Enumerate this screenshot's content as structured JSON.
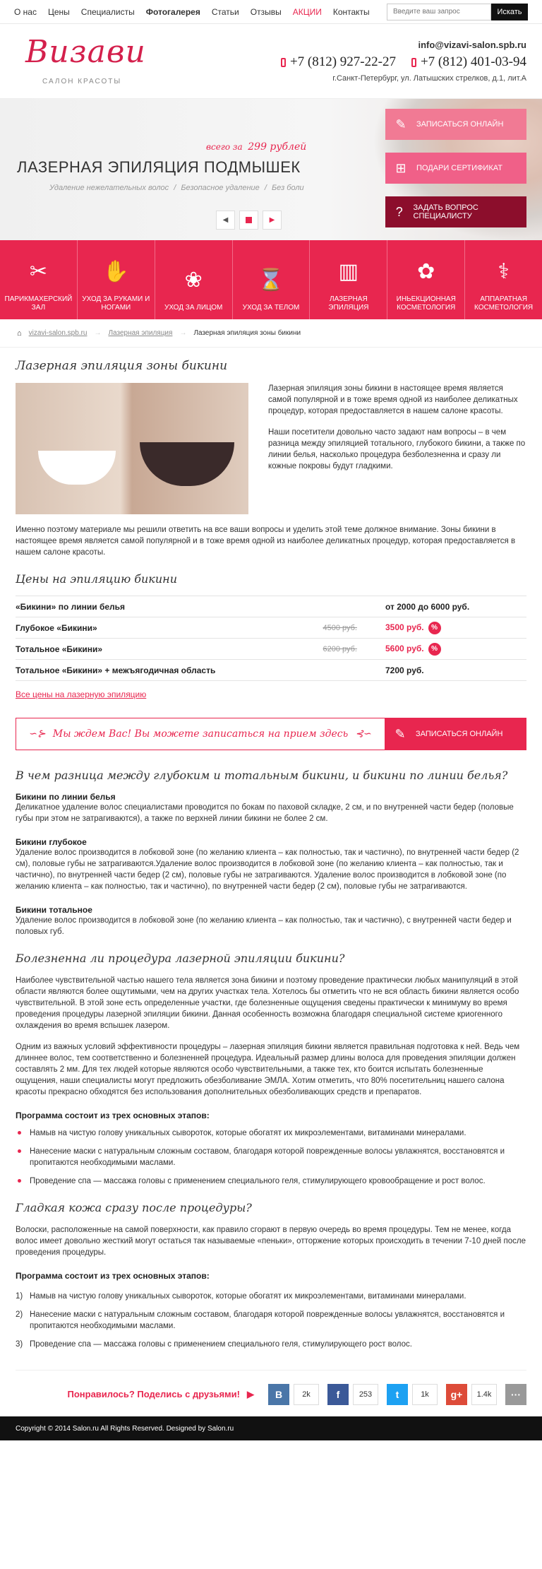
{
  "topnav": {
    "items": [
      "О нас",
      "Цены",
      "Специалисты",
      "Фотогалерея",
      "Статьи",
      "Отзывы",
      "АКЦИИ",
      "Контакты"
    ],
    "search_placeholder": "Введите ваш запрос",
    "search_button": "Искать"
  },
  "header": {
    "logo": "Визави",
    "logo_sub": "САЛОН     КРАСОТЫ",
    "email": "info@vizavi-salon.spb.ru",
    "phone1": "+7 (812) 927-22-27",
    "phone2": "+7 (812) 401-03-94",
    "address": "г.Санкт-Петербург, ул. Латышских стрелков,  д.1, лит.А"
  },
  "banner": {
    "price_prefix": "всего за",
    "price": "299 рублей",
    "title": "ЛАЗЕРНАЯ ЭПИЛЯЦИЯ ПОДМЫШЕК",
    "features": [
      "Удаление нежелательных волос",
      "Безопасное удаление",
      "Без боли"
    ],
    "cta1": "ЗАПИСАТЬСЯ ОНЛАЙН",
    "cta2": "ПОДАРИ СЕРТИФИКАТ",
    "cta3": "ЗАДАТЬ ВОПРОС СПЕЦИАЛИСТУ"
  },
  "categories": [
    {
      "label": "ПАРИКМАХЕРСКИЙ ЗАЛ",
      "icon": "scissors-icon",
      "glyph": "✂"
    },
    {
      "label": "УХОД ЗА РУКАМИ И НОГАМИ",
      "icon": "hand-icon",
      "glyph": "✋"
    },
    {
      "label": "УХОД ЗА ЛИЦОМ",
      "icon": "flower-icon",
      "glyph": "❀"
    },
    {
      "label": "УХОД ЗА ТЕЛОМ",
      "icon": "corset-icon",
      "glyph": "⌛"
    },
    {
      "label": "ЛАЗЕРНАЯ ЭПИЛЯЦИЯ",
      "icon": "laser-device-icon",
      "glyph": "▥"
    },
    {
      "label": "ИНЬЕКЦИОННАЯ КОСМЕТОЛОГИЯ",
      "icon": "face-flower-icon",
      "glyph": "✿"
    },
    {
      "label": "АППАРАТНАЯ КОСМЕТОЛОГИЯ",
      "icon": "apparatus-icon",
      "glyph": "⚕"
    }
  ],
  "breadcrumb": {
    "home": "vizavi-salon.spb.ru",
    "section": "Лазерная эпиляция",
    "current": "Лазерная эпиляция зоны бикини"
  },
  "content": {
    "h1": "Лазерная эпиляция зоны бикини",
    "intro_p1": "Лазерная эпиляция зоны бикини в настоящее время является самой популярной и в тоже время одной из наиболее деликатных процедур, которая предоставляется в нашем салоне красоты.",
    "intro_p2": "Наши посетители довольно часто задают нам вопросы – в чем разница между эпиляцией тотального, глубокого бикини, а также по линии белья, насколько процедура безболезненна и сразу ли кожные покровы будут гладкими.",
    "p3": "Именно поэтому материале мы решили ответить на все ваши вопросы и уделить этой теме должное внимание. Зоны бикини в настоящее время является самой популярной и в тоже время одной из наиболее деликатных процедур, которая предоставляется в нашем салоне красоты.",
    "prices_h": "Цены на эпиляцию бикини",
    "prices": [
      {
        "name": "«Бикини» по линии белья",
        "old": "",
        "new": "от 2000 до 6000 руб.",
        "sale": false
      },
      {
        "name": "Глубокое «Бикини»",
        "old": "4500 руб.",
        "new": "3500 руб.",
        "sale": true
      },
      {
        "name": "Тотальное «Бикини»",
        "old": "6200 руб.",
        "new": "5600 руб.",
        "sale": true
      },
      {
        "name": "Тотальное «Бикини» + межъягодичная область",
        "old": "",
        "new": "7200 руб.",
        "sale": false
      }
    ],
    "badge": "%",
    "all_prices": "Все цены на лазерную эпиляцию",
    "signup_msg": "Мы ждем Вас! Вы можете записаться на прием здесь",
    "signup_btn": "ЗАПИСАТЬСЯ ОНЛАЙН",
    "q1": "В чем разница между глубоким и тотальным бикини, и бикини по линии белья?",
    "s1_h": "Бикини по линии белья",
    "s1_p": "Деликатное удаление волос специалистами проводится по бокам по паховой складке, 2 см, и по внутренней части бедер (половые губы при этом не затрагиваются), а также по верхней линии бикини не более 2 см.",
    "s2_h": "Бикини глубокое",
    "s2_p": "Удаление волос производится в лобковой зоне (по желанию клиента – как полностью, так и частично), по внутренней части бедер (2 см), половые губы не затрагиваются.Удаление волос производится в лобковой зоне (по желанию клиента – как полностью, так и частично), по внутренней части бедер (2 см), половые губы не затрагиваются. Удаление волос производится в лобковой зоне (по желанию клиента – как полностью, так и частично), по внутренней части бедер (2 см), половые губы не затрагиваются.",
    "s3_h": "Бикини тотальное",
    "s3_p": "Удаление волос производится в лобковой зоне (по желанию клиента – как полностью, так и частично), с внутренней части бедер и половых губ.",
    "q2": "Болезненна ли процедура лазерной эпиляции бикини?",
    "q2_p1": "Наиболее чувствительной частью нашего тела является зона бикини и поэтому проведение практически любых манипуляций в этой области являются более ощутимыми, чем на других участках тела. Хотелось бы отметить что не вся область бикини является особо чувствительной. В этой зоне есть определенные участки, где болезненные ощущения сведены практически к минимуму во время проведения процедуры лазерной эпиляции бикини. Данная особенность возможна благодаря специальной системе криогенного охлаждения во время вспышек лазером.",
    "q2_p2": "Одним из важных условий эффективности процедуры – лазерная эпиляция бикини является правильная подготовка к ней. Ведь чем длиннее волос, тем соответственно и болезненней процедура. Идеальный размер длины волоса для проведения эпиляции должен составлять 2 мм. Для тех людей которые являются особо чувствительными, а также тех, кто боится испытать болезненные ощущения, наши специалисты могут предложить обезболивание ЭМЛА. Хотим отметить, что 80% посетительниц нашего салона красоты прекрасно обходятся без использования дополнительных обезболивающих средств и препаратов.",
    "steps_h": "Программа состоит из трех основных этапов:",
    "steps": [
      "Намыв на чистую голову уникальных сывороток, которые обогатят их микроэлементами, витаминами минералами.",
      "Нанесение маски с натуральным сложным составом, благодаря которой поврежденные волосы увлажнятся, восстановятся и пропитаются необходимыми маслами.",
      "Проведение спа — массажа головы с применением специального геля, стимулирующего кровообращение и рост волос."
    ],
    "q3": "Гладкая кожа сразу после процедуры?",
    "q3_p": "Волоски, расположенные на самой поверхности, как правило сгорают в первую очередь во время процедуры. Тем не менее, когда волос имеет довольно жесткий могут остаться так называемые «пеньки», отторжение которых происходить в течении 7-10 дней после проведения процедуры.",
    "steps2_h": "Программа состоит из трех основных этапов:",
    "steps2": [
      {
        "n": "1)",
        "t": "Намыв на чистую голову уникальных сывороток, которые обогатят их микроэлементами, витаминами минералами."
      },
      {
        "n": "2)",
        "t": "Нанесение маски с натуральным сложным составом, благодаря которой поврежденные волосы увлажнятся, восстановятся и пропитаются необходимыми маслами."
      },
      {
        "n": "3)",
        "t": "Проведение спа — массажа головы с применением специального геля, стимулирующего  рост волос."
      }
    ]
  },
  "share": {
    "label": "Понравилось? Поделись с друзьями!",
    "vk": "В",
    "vk_count": "2k",
    "fb": "f",
    "fb_count": "253",
    "tw": "t",
    "tw_count": "1k",
    "gp": "g+",
    "gp_count": "1.4k",
    "more": "···"
  },
  "footer": "Copyright © 2014 Salon.ru All Rights Reserved. Designed by Salon.ru"
}
